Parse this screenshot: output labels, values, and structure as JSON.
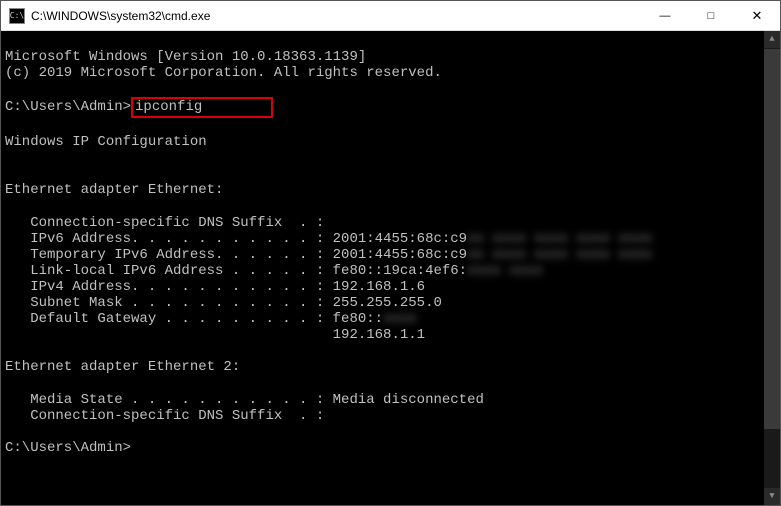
{
  "titlebar": {
    "icon_label": "C:\\",
    "title": "C:\\WINDOWS\\system32\\cmd.exe",
    "minimize": "—",
    "maximize": "□",
    "close": "✕"
  },
  "console": {
    "line1": "Microsoft Windows [Version 10.0.18363.1139]",
    "line2": "(c) 2019 Microsoft Corporation. All rights reserved.",
    "prompt1_path": "C:\\Users\\Admin>",
    "prompt1_cmd": "ipconfig",
    "highlight_pad": "        ",
    "heading_winip": "Windows IP Configuration",
    "heading_eth": "Ethernet adapter Ethernet:",
    "eth": {
      "dns_suffix": "   Connection-specific DNS Suffix  . :",
      "ipv6_label": "   IPv6 Address. . . . . . . . . . . : ",
      "ipv6_val": "2001:4455:68c:c9",
      "ipv6_blur": "xx xxxx xxxx xxxx xxxx",
      "tmp6_label": "   Temporary IPv6 Address. . . . . . : ",
      "tmp6_val": "2001:4455:68c:c9",
      "tmp6_blur": "xx xxxx xxxx xxxx xxxx",
      "ll6_label": "   Link-local IPv6 Address . . . . . : ",
      "ll6_val": "fe80::19ca:4ef6:",
      "ll6_blur": "xxxx xxxx",
      "ipv4": "   IPv4 Address. . . . . . . . . . . : 192.168.1.6",
      "subnet": "   Subnet Mask . . . . . . . . . . . : 255.255.255.0",
      "gw_label": "   Default Gateway . . . . . . . . . : ",
      "gw_val": "fe80::",
      "gw_blur": "xxxx",
      "gw2": "                                       192.168.1.1"
    },
    "heading_eth2": "Ethernet adapter Ethernet 2:",
    "eth2": {
      "media": "   Media State . . . . . . . . . . . : Media disconnected",
      "dns_suffix": "   Connection-specific DNS Suffix  . :"
    },
    "prompt2": "C:\\Users\\Admin>"
  }
}
